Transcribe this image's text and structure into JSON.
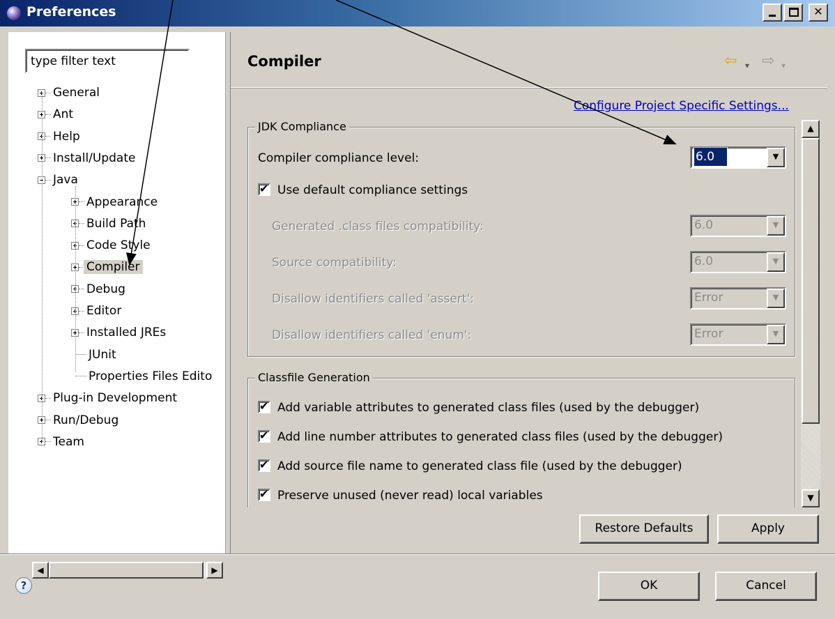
{
  "window": {
    "title": "Preferences",
    "controls": {
      "minimize": "_",
      "maximize": "□",
      "close": "✕"
    }
  },
  "filter": {
    "value": "type filter text"
  },
  "tree": {
    "items": [
      {
        "label": "General",
        "expander": "plus",
        "indent": 0
      },
      {
        "label": "Ant",
        "expander": "plus",
        "indent": 0
      },
      {
        "label": "Help",
        "expander": "plus",
        "indent": 0
      },
      {
        "label": "Install/Update",
        "expander": "plus",
        "indent": 0
      },
      {
        "label": "Java",
        "expander": "minus",
        "indent": 0
      },
      {
        "label": "Appearance",
        "expander": "plus",
        "indent": 1
      },
      {
        "label": "Build Path",
        "expander": "plus",
        "indent": 1
      },
      {
        "label": "Code Style",
        "expander": "plus",
        "indent": 1
      },
      {
        "label": "Compiler",
        "expander": "plus",
        "indent": 1,
        "selected": true
      },
      {
        "label": "Debug",
        "expander": "plus",
        "indent": 1
      },
      {
        "label": "Editor",
        "expander": "plus",
        "indent": 1
      },
      {
        "label": "Installed JREs",
        "expander": "plus",
        "indent": 1
      },
      {
        "label": "JUnit",
        "expander": "none",
        "indent": 1
      },
      {
        "label": "Properties Files Edito",
        "expander": "none",
        "indent": 1
      },
      {
        "label": "Plug-in Development",
        "expander": "plus",
        "indent": 0
      },
      {
        "label": "Run/Debug",
        "expander": "plus",
        "indent": 0
      },
      {
        "label": "Team",
        "expander": "plus",
        "indent": 0
      }
    ]
  },
  "page": {
    "title": "Compiler",
    "nav": {
      "back": "⇦",
      "dropdown": "▾",
      "forward": "⇨"
    },
    "configure_link": "Configure Project Specific Settings..."
  },
  "jdk": {
    "legend": "JDK Compliance",
    "compliance_label": "Compiler compliance level:",
    "compliance_value": "6.0",
    "use_default_label": "Use default compliance settings",
    "use_default_checked": true,
    "generated_label": "Generated .class files compatibility:",
    "generated_value": "6.0",
    "source_label": "Source compatibility:",
    "source_value": "6.0",
    "assert_label": "Disallow identifiers called 'assert':",
    "assert_value": "Error",
    "enum_label": "Disallow identifiers called 'enum':",
    "enum_value": "Error"
  },
  "classfile": {
    "legend": "Classfile Generation",
    "options": [
      {
        "label": "Add variable attributes to generated class files (used by the debugger)",
        "checked": true
      },
      {
        "label": "Add line number attributes to generated class files (used by the debugger)",
        "checked": true
      },
      {
        "label": "Add source file name to generated class file (used by the debugger)",
        "checked": true
      },
      {
        "label": "Preserve unused (never read) local variables",
        "checked": true
      }
    ]
  },
  "buttons": {
    "restore_defaults": "Restore Defaults",
    "apply": "Apply",
    "ok": "OK",
    "cancel": "Cancel",
    "help": "?"
  },
  "scroll": {
    "up": "▲",
    "down": "▼",
    "left": "◀",
    "right": "▶"
  },
  "colors": {
    "titlebar_start": "#0a246a",
    "titlebar_end": "#a6caf0",
    "link": "#0000c0",
    "selection": "#0a246a"
  }
}
